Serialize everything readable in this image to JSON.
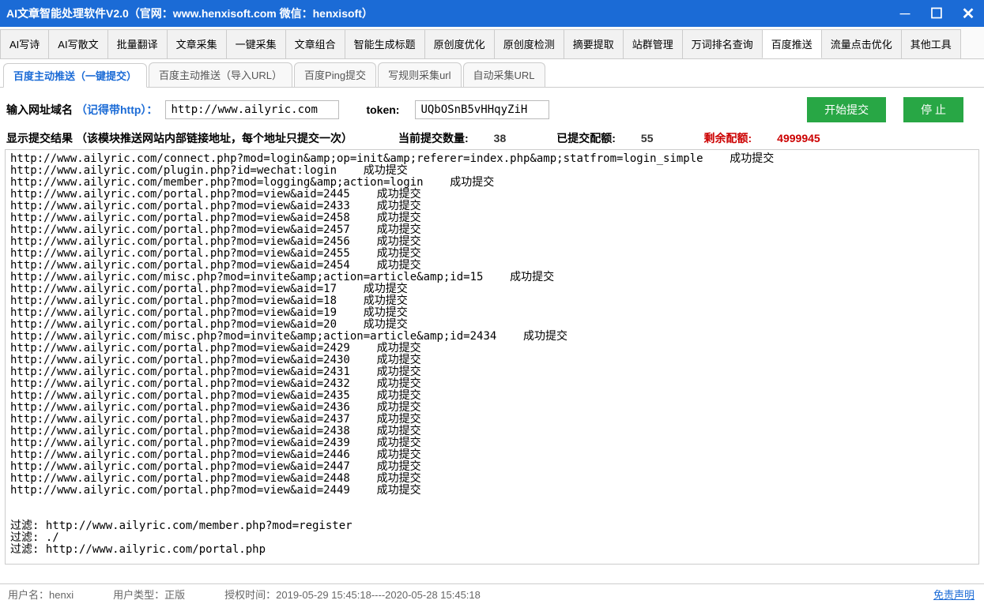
{
  "window": {
    "title": "AI文章智能处理软件V2.0（官网：www.henxisoft.com  微信：henxisoft）"
  },
  "tabs_main": [
    "AI写诗",
    "AI写散文",
    "批量翻译",
    "文章采集",
    "一键采集",
    "文章组合",
    "智能生成标题",
    "原创度优化",
    "原创度检测",
    "摘要提取",
    "站群管理",
    "万词排名查询",
    "百度推送",
    "流量点击优化",
    "其他工具"
  ],
  "tabs_main_active": 12,
  "tabs_sub": [
    "百度主动推送（一键提交）",
    "百度主动推送（导入URL）",
    "百度Ping提交",
    "写规则采集url",
    "自动采集URL"
  ],
  "tabs_sub_active": 0,
  "inputs": {
    "url_label": "输入网址域名",
    "url_hint": "（记得带http）：",
    "url_value": "http://www.ailyric.com",
    "token_label": "token:",
    "token_value": "UQbOSnB5vHHqyZiH",
    "btn_start": "开始提交",
    "btn_stop": "停  止"
  },
  "result_bar": {
    "label_left": "显示提交结果",
    "label_desc": "（该模块推送网站内部链接地址，每个地址只提交一次）",
    "label_current": "当前提交数量:",
    "value_current": "38",
    "label_done": "已提交配额:",
    "value_done": "55",
    "label_remain": "剩余配额:",
    "value_remain": "4999945"
  },
  "log": "http://www.ailyric.com/connect.php?mod=login&amp;op=init&amp;referer=index.php&amp;statfrom=login_simple    成功提交\nhttp://www.ailyric.com/plugin.php?id=wechat:login    成功提交\nhttp://www.ailyric.com/member.php?mod=logging&amp;action=login    成功提交\nhttp://www.ailyric.com/portal.php?mod=view&aid=2445    成功提交\nhttp://www.ailyric.com/portal.php?mod=view&aid=2433    成功提交\nhttp://www.ailyric.com/portal.php?mod=view&aid=2458    成功提交\nhttp://www.ailyric.com/portal.php?mod=view&aid=2457    成功提交\nhttp://www.ailyric.com/portal.php?mod=view&aid=2456    成功提交\nhttp://www.ailyric.com/portal.php?mod=view&aid=2455    成功提交\nhttp://www.ailyric.com/portal.php?mod=view&aid=2454    成功提交\nhttp://www.ailyric.com/misc.php?mod=invite&amp;action=article&amp;id=15    成功提交\nhttp://www.ailyric.com/portal.php?mod=view&aid=17    成功提交\nhttp://www.ailyric.com/portal.php?mod=view&aid=18    成功提交\nhttp://www.ailyric.com/portal.php?mod=view&aid=19    成功提交\nhttp://www.ailyric.com/portal.php?mod=view&aid=20    成功提交\nhttp://www.ailyric.com/misc.php?mod=invite&amp;action=article&amp;id=2434    成功提交\nhttp://www.ailyric.com/portal.php?mod=view&aid=2429    成功提交\nhttp://www.ailyric.com/portal.php?mod=view&aid=2430    成功提交\nhttp://www.ailyric.com/portal.php?mod=view&aid=2431    成功提交\nhttp://www.ailyric.com/portal.php?mod=view&aid=2432    成功提交\nhttp://www.ailyric.com/portal.php?mod=view&aid=2435    成功提交\nhttp://www.ailyric.com/portal.php?mod=view&aid=2436    成功提交\nhttp://www.ailyric.com/portal.php?mod=view&aid=2437    成功提交\nhttp://www.ailyric.com/portal.php?mod=view&aid=2438    成功提交\nhttp://www.ailyric.com/portal.php?mod=view&aid=2439    成功提交\nhttp://www.ailyric.com/portal.php?mod=view&aid=2446    成功提交\nhttp://www.ailyric.com/portal.php?mod=view&aid=2447    成功提交\nhttp://www.ailyric.com/portal.php?mod=view&aid=2448    成功提交\nhttp://www.ailyric.com/portal.php?mod=view&aid=2449    成功提交\n\n\n过滤: http://www.ailyric.com/member.php?mod=register\n过滤: ./\n过滤: http://www.ailyric.com/portal.php",
  "footer": {
    "user_label": "用户名：",
    "user_value": "henxi",
    "type_label": "用户类型：",
    "type_value": "正版",
    "auth_label": "授权时间：",
    "auth_value": "2019-05-29 15:45:18----2020-05-28 15:45:18",
    "disclaimer": "免责声明"
  }
}
